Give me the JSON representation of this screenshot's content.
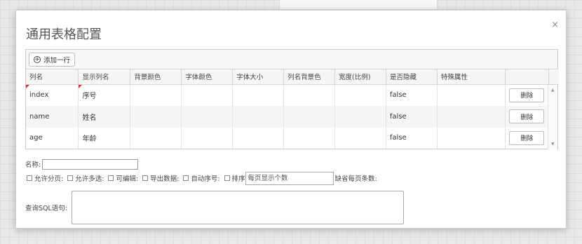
{
  "dialog": {
    "title": "通用表格配置",
    "close_glyph": "×"
  },
  "toolbar": {
    "add_row_label": "添加一行",
    "add_icon_glyph": "+"
  },
  "table": {
    "columns": [
      "列名",
      "显示列名",
      "背景颜色",
      "字体颜色",
      "字体大小",
      "列名背景色",
      "宽度(比例)",
      "是否隐藏",
      "特殊属性",
      ""
    ],
    "rows": [
      {
        "name": "index",
        "display": "序号",
        "bg": "",
        "font_color": "",
        "font_size": "",
        "header_bg": "",
        "width": "",
        "hidden": "false",
        "special": "",
        "action": "删除"
      },
      {
        "name": "name",
        "display": "姓名",
        "bg": "",
        "font_color": "",
        "font_size": "",
        "header_bg": "",
        "width": "",
        "hidden": "false",
        "special": "",
        "action": "删除"
      },
      {
        "name": "age",
        "display": "年龄",
        "bg": "",
        "font_color": "",
        "font_size": "",
        "header_bg": "",
        "width": "",
        "hidden": "false",
        "special": "",
        "action": "删除"
      }
    ]
  },
  "form": {
    "name_label": "名称:",
    "name_value": "",
    "options": [
      {
        "label": "允许分页:",
        "checked": false
      },
      {
        "label": "允许多选:",
        "checked": false
      },
      {
        "label": "可编辑:",
        "checked": false
      },
      {
        "label": "导出数据:",
        "checked": false
      },
      {
        "label": "自动序号:",
        "checked": false
      },
      {
        "label": "排序",
        "checked": false
      }
    ],
    "page_size_placeholder": "每页显示个数",
    "default_page_size_label": "缺省每页条数:",
    "sql_label": "查询SQL语句:",
    "sql_value": ""
  }
}
